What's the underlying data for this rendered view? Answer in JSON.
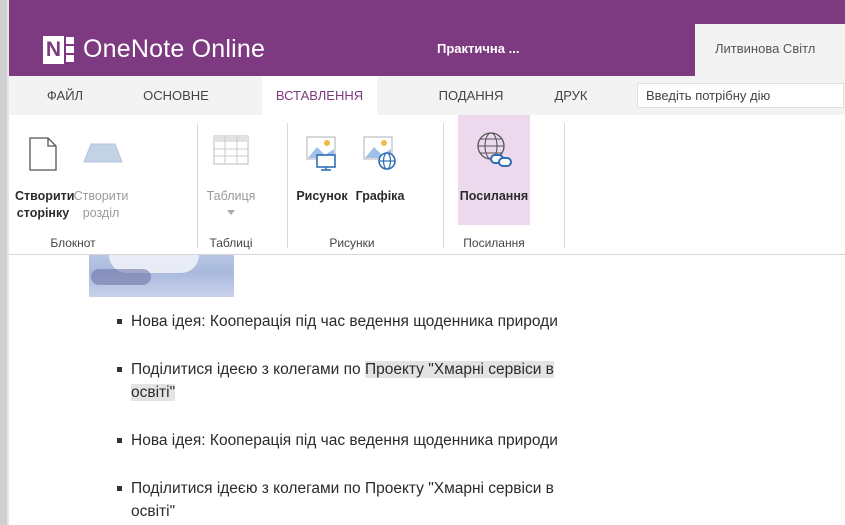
{
  "titlebar": {
    "app_name": "OneNote Online",
    "notebook": "Практична ...",
    "user": "Литвинова Світл",
    "brand_color": "#7d3a80"
  },
  "tabs": [
    {
      "label": "ФАЙЛ"
    },
    {
      "label": "ОСНОВНЕ"
    },
    {
      "label": "ВСТАВЛЕННЯ",
      "active": true
    },
    {
      "label": "ПОДАННЯ"
    },
    {
      "label": "ДРУК"
    }
  ],
  "tell_me": {
    "placeholder": "Введіть потрібну дію"
  },
  "ribbon": {
    "groups": [
      {
        "label": "Блокнот",
        "buttons": [
          {
            "label1": "Створити",
            "label2": "сторінку",
            "icon": "new-page-icon"
          },
          {
            "label1": "Створити",
            "label2": "розділ",
            "icon": "new-section-icon",
            "disabled": true
          }
        ]
      },
      {
        "label": "Таблиці",
        "buttons": [
          {
            "label1": "Таблиця",
            "icon": "table-icon",
            "disabled": true
          }
        ]
      },
      {
        "label": "Рисунки",
        "buttons": [
          {
            "label1": "Рисунок",
            "icon": "picture-icon"
          },
          {
            "label1": "Графіка",
            "icon": "online-picture-icon"
          }
        ]
      },
      {
        "label": "Посилання",
        "buttons": [
          {
            "label1": "Посилання",
            "icon": "link-icon",
            "active": true
          }
        ]
      }
    ]
  },
  "content": {
    "items": [
      {
        "text": "Нова ідея: Кооперація під час ведення щоденника природи"
      },
      {
        "pre": "Поділитися ідеєю з колегами по ",
        "highlight_1": "Проекту \"Хмарні сервіси в",
        "highlight_2": "освіті\""
      },
      {
        "text": "Нова ідея: Кооперація під час ведення щоденника природи"
      },
      {
        "line1": "Поділитися ідеєю з колегами по Проекту \"Хмарні сервіси в",
        "line2": "освіті\""
      }
    ]
  }
}
